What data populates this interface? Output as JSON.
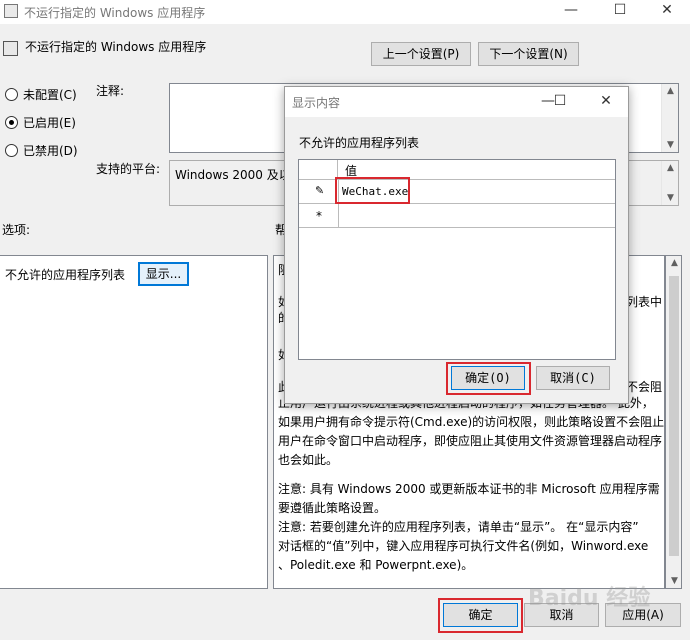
{
  "window": {
    "title": "不运行指定的 Windows 应用程序",
    "min": "—",
    "max": "☐",
    "close": "✕"
  },
  "header": {
    "policy_name": "不运行指定的 Windows 应用程序",
    "prev_button": "上一个设置(P)",
    "next_button": "下一个设置(N)"
  },
  "radios": [
    {
      "label": "未配置(C)",
      "selected": false
    },
    {
      "label": "已启用(E)",
      "selected": true
    },
    {
      "label": "已禁用(D)",
      "selected": false
    }
  ],
  "comment_label": "注释:",
  "platform_label": "支持的平台:",
  "platform_value": "Windows 2000 及以",
  "options_label": "选项:",
  "help_label": "帮",
  "options": {
    "list_label": "不允许的应用程序列表",
    "show_button": "显示..."
  },
  "help_text": {
    "fragments": [
      "阻",
      "如",
      "的",
      "如",
      "此",
      "列表中",
      "不会阻"
    ],
    "p1_line1": "止用户运行由系统进程或其他进程启动的程序，如任务管理器。 此外，",
    "p1_line2": "如果用户拥有命令提示符(Cmd.exe)的访问权限，则此策略设置不会阻止",
    "p1_line3": "用户在命令窗口中启动程序，即使应阻止其使用文件资源管理器启动程序",
    "p1_line4": "也会如此。",
    "p2_line1": "注意: 具有 Windows 2000 或更新版本证书的非 Microsoft 应用程序需",
    "p2_line2": "要遵循此策略设置。",
    "p3_line1": "注意: 若要创建允许的应用程序列表，请单击“显示”。 在“显示内容”",
    "p3_line2": "对话框的“值”列中，键入应用程序可执行文件名(例如，Winword.exe",
    "p3_line3": "、Poledit.exe 和 Powerpnt.exe)。"
  },
  "bottom_buttons": {
    "ok": "确定",
    "cancel": "取消",
    "apply": "应用(A)"
  },
  "dialog": {
    "title": "显示内容",
    "list_title": "不允许的应用程序列表",
    "column_header": "值",
    "rows": [
      {
        "marker": "✎",
        "value": "WeChat.exe"
      },
      {
        "marker": "*",
        "value": ""
      }
    ],
    "ok_button": "确定(O)",
    "cancel_button": "取消(C)",
    "min": "—",
    "max": "☐",
    "close": "✕"
  },
  "watermark": "Baidu 经验",
  "colors": {
    "highlight_red": "#d9282f",
    "focus_blue": "#0078d7",
    "window_bg": "#f0f0f0"
  }
}
